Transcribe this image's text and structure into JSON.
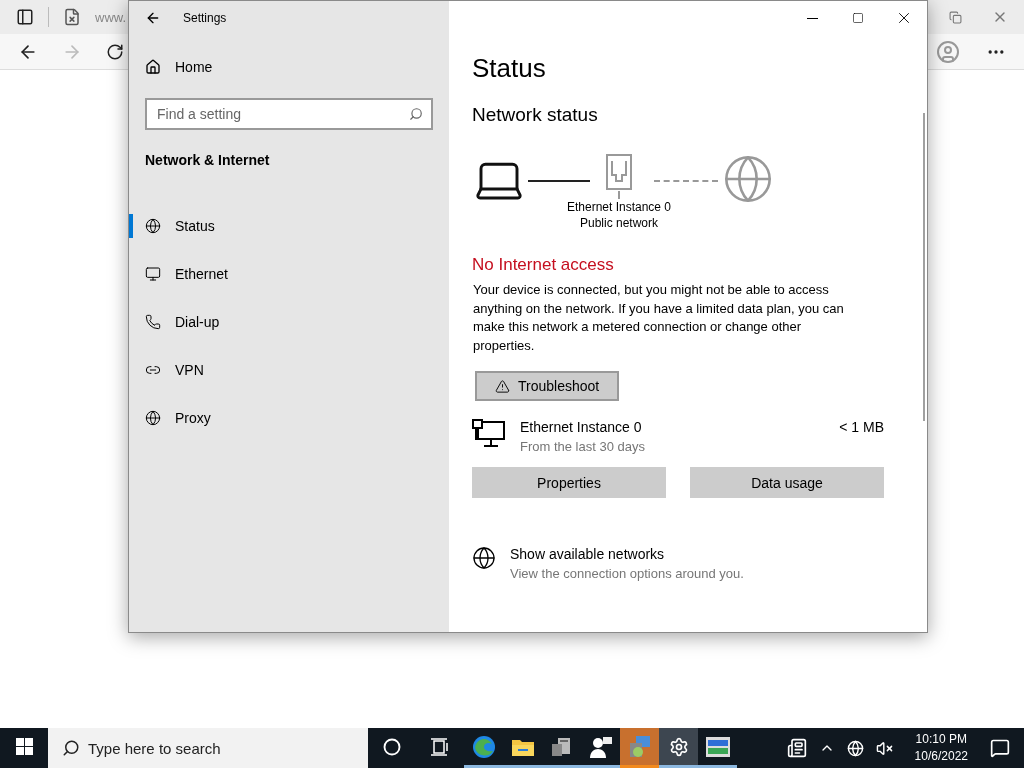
{
  "browser": {
    "tab_title": "www."
  },
  "settings_window": {
    "title": "Settings",
    "sidebar": {
      "home": "Home",
      "search": {
        "placeholder": "Find a setting"
      },
      "section": "Network & Internet",
      "items": [
        {
          "label": "Status",
          "selected": true
        },
        {
          "label": "Ethernet",
          "selected": false
        },
        {
          "label": "Dial-up",
          "selected": false
        },
        {
          "label": "VPN",
          "selected": false
        },
        {
          "label": "Proxy",
          "selected": false
        }
      ]
    },
    "content": {
      "heading": "Status",
      "subheading": "Network status",
      "diagram": {
        "adapter": "Ethernet Instance 0",
        "network": "Public network",
        "internet_connected": false
      },
      "alert": "No Internet access",
      "message": "Your device is connected, but you might not be able to access anything on the network. If you have a limited data plan, you can make this network a metered connection or change other properties.",
      "troubleshoot_button": "Troubleshoot",
      "usage": {
        "name": "Ethernet Instance 0",
        "period": "From the last 30 days",
        "amount": "< 1 MB"
      },
      "buttons": [
        "Properties",
        "Data usage"
      ],
      "networks_link": {
        "title": "Show available networks",
        "description": "View the connection options around you."
      }
    }
  },
  "taskbar": {
    "search": {
      "placeholder": "Type here to search"
    },
    "apps": [
      {
        "running": false,
        "selected": false,
        "attention": false
      },
      {
        "running": false,
        "selected": false,
        "attention": false
      },
      {
        "running": true,
        "selected": false,
        "attention": false
      },
      {
        "running": true,
        "selected": false,
        "attention": false
      },
      {
        "running": true,
        "selected": false,
        "attention": false
      },
      {
        "running": true,
        "selected": false,
        "attention": false
      },
      {
        "running": true,
        "selected": false,
        "attention": true
      },
      {
        "running": true,
        "selected": true,
        "attention": false
      },
      {
        "running": true,
        "selected": false,
        "attention": false
      }
    ],
    "time": "10:10 PM",
    "date": "10/6/2022"
  }
}
